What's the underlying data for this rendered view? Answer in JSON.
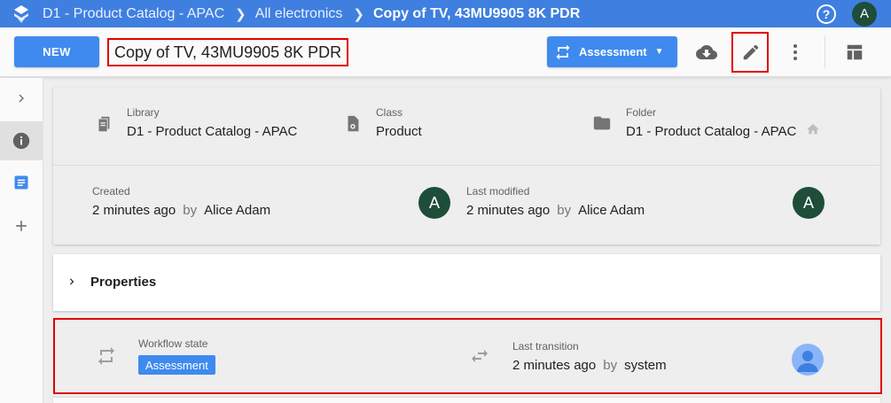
{
  "topbar": {
    "breadcrumbs": [
      {
        "label": "D1 - Product Catalog - APAC"
      },
      {
        "label": "All electronics"
      },
      {
        "label": "Copy of TV, 43MU9905 8K PDR"
      }
    ],
    "user_initial": "A",
    "help_glyph": "?"
  },
  "toolbar": {
    "new_label": "NEW",
    "document_title": "Copy of TV, 43MU9905 8K PDR",
    "state_label": "Assessment"
  },
  "info": {
    "library": {
      "label": "Library",
      "value": "D1 - Product Catalog - APAC"
    },
    "class": {
      "label": "Class",
      "value": "Product"
    },
    "folder": {
      "label": "Folder",
      "value": "D1 - Product Catalog - APAC"
    },
    "created": {
      "label": "Created",
      "time": "2 minutes ago",
      "by": "by",
      "user": "Alice Adam",
      "initial": "A"
    },
    "modified": {
      "label": "Last modified",
      "time": "2 minutes ago",
      "by": "by",
      "user": "Alice Adam",
      "initial": "A"
    }
  },
  "properties": {
    "title": "Properties"
  },
  "workflow": {
    "state_label": "Workflow state",
    "state_value": "Assessment",
    "transition_label": "Last transition",
    "transition_time": "2 minutes ago",
    "by": "by",
    "transition_user": "system"
  },
  "colors": {
    "primary": "#3f8aef",
    "topbar": "#3f7fe0",
    "highlight": "#e00000",
    "avatar": "#1e4d3a"
  }
}
